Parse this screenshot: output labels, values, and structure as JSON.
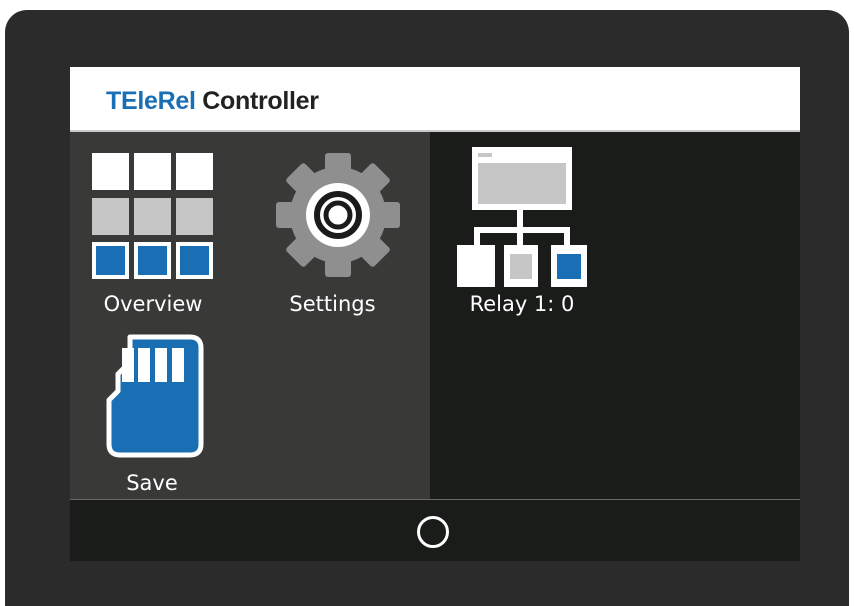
{
  "header": {
    "brand": "TEleRel",
    "title": "Controller"
  },
  "tiles": [
    {
      "label": "Overview",
      "icon": "grid-icon"
    },
    {
      "label": "Settings",
      "icon": "gear-icon"
    },
    {
      "label": "Relay 1: 0",
      "icon": "relay-tree-icon"
    },
    {
      "label": "Save",
      "icon": "sd-card-icon"
    }
  ],
  "footer": {
    "home_icon": "home-circle-icon"
  },
  "colors": {
    "brand_blue": "#1a6fb4",
    "panel_left": "#393a38",
    "panel_right": "#1a1c1a",
    "bezel": "#2b2b2b",
    "icon_grey": "#c6c6c6",
    "gear_grey": "#8f8f8f"
  }
}
